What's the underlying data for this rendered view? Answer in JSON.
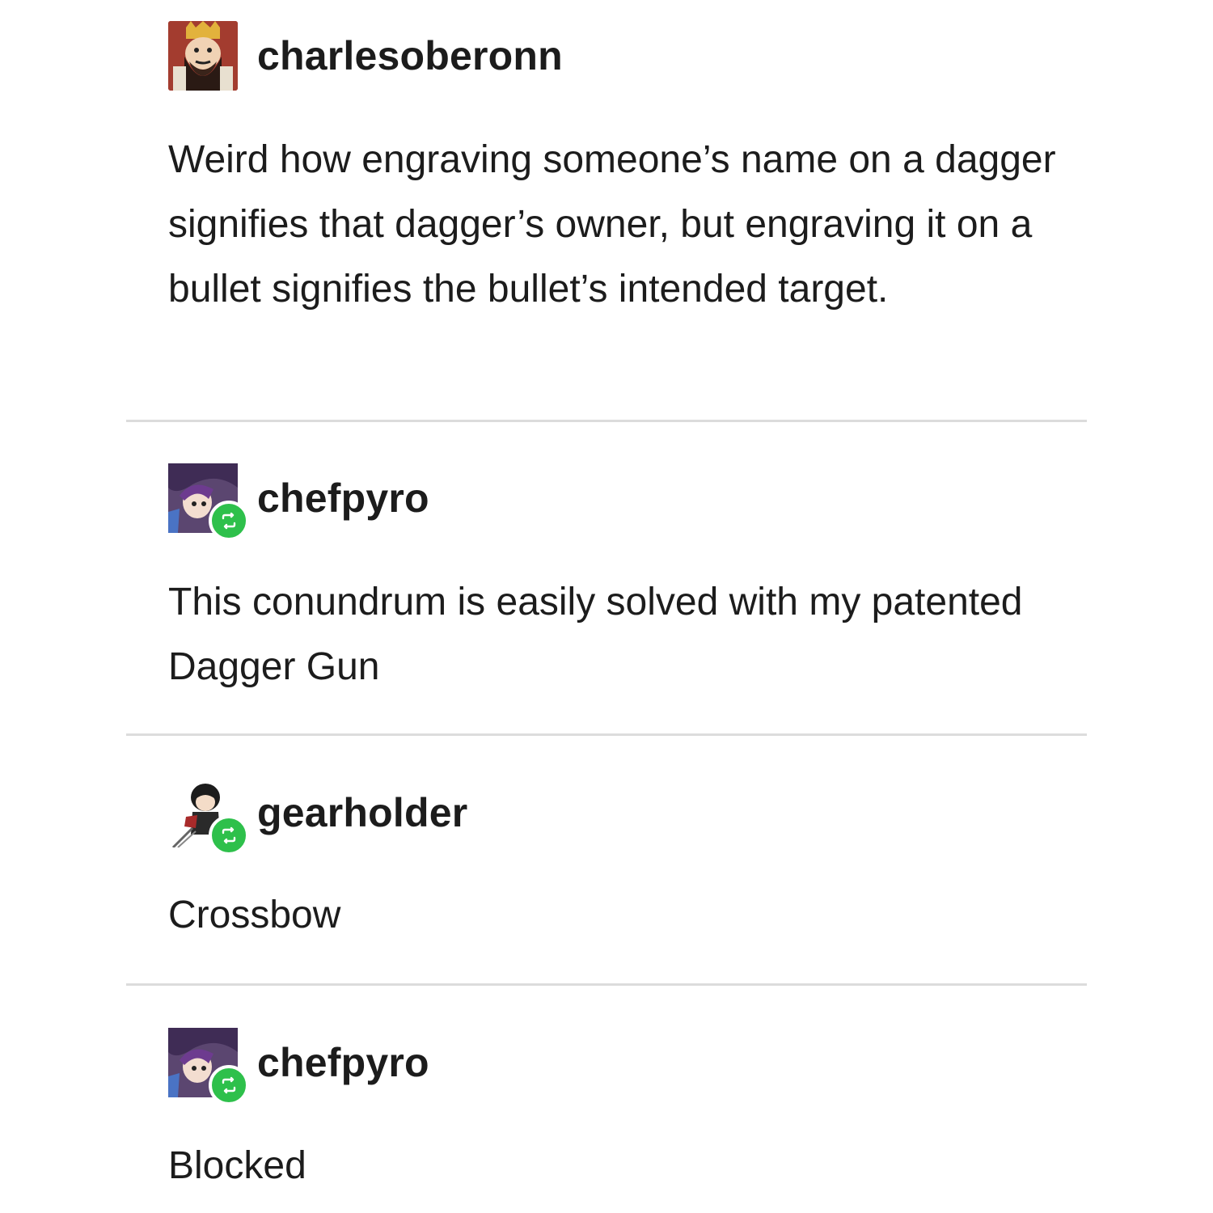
{
  "posts": [
    {
      "username": "charlesoberonn",
      "avatar_icon": "crowned-bearded-man-avatar",
      "reblog": false,
      "text": "Weird how engraving someone’s name on a dagger signifies that dagger’s owner, but engraving it on a bullet signifies the bullet’s intended target."
    },
    {
      "username": "chefpyro",
      "avatar_icon": "purple-haired-character-avatar",
      "reblog": true,
      "text": "This conundrum is easily solved with my patented Dagger Gun"
    },
    {
      "username": "gearholder",
      "avatar_icon": "chibi-character-avatar",
      "reblog": true,
      "text": "Crossbow"
    },
    {
      "username": "chefpyro",
      "avatar_icon": "purple-haired-character-avatar",
      "reblog": true,
      "text": "Blocked"
    }
  ],
  "colors": {
    "background": "#ffffff",
    "text": "#1c1c1c",
    "divider": "#dcdcdc",
    "reblog_badge": "#2ec04b"
  },
  "icons": {
    "reblog_badge": "reblog-icon"
  }
}
